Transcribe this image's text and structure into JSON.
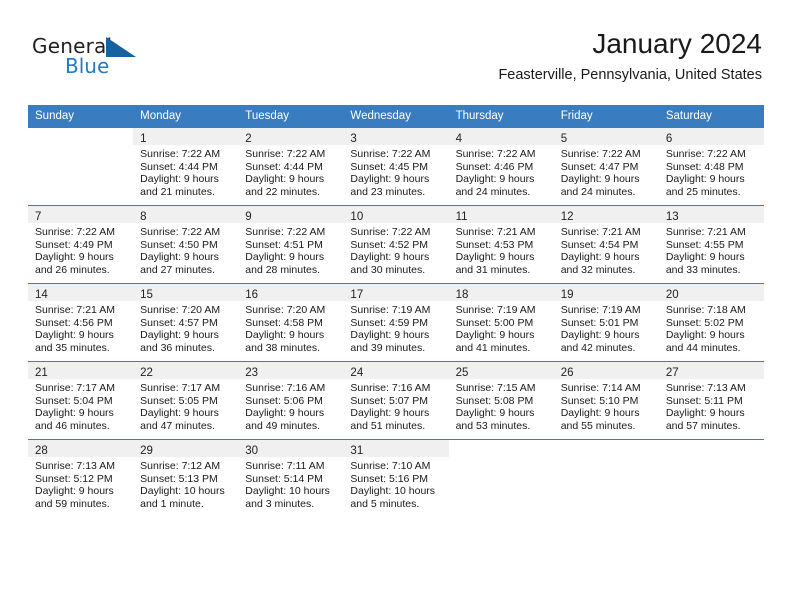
{
  "brand": {
    "word1": "General",
    "word2": "Blue",
    "logo_icon": "triangle-logo-icon",
    "accent_color": "#1e7bc4"
  },
  "header": {
    "title": "January 2024",
    "location": "Feasterville, Pennsylvania, United States"
  },
  "calendar": {
    "header_bg": "#3a7cc0",
    "daynum_bg": "#f0f0f0",
    "weekdays": [
      "Sunday",
      "Monday",
      "Tuesday",
      "Wednesday",
      "Thursday",
      "Friday",
      "Saturday"
    ],
    "weeks": [
      [
        {
          "day": "",
          "lines": []
        },
        {
          "day": "1",
          "lines": [
            "Sunrise: 7:22 AM",
            "Sunset: 4:44 PM",
            "Daylight: 9 hours",
            "and 21 minutes."
          ]
        },
        {
          "day": "2",
          "lines": [
            "Sunrise: 7:22 AM",
            "Sunset: 4:44 PM",
            "Daylight: 9 hours",
            "and 22 minutes."
          ]
        },
        {
          "day": "3",
          "lines": [
            "Sunrise: 7:22 AM",
            "Sunset: 4:45 PM",
            "Daylight: 9 hours",
            "and 23 minutes."
          ]
        },
        {
          "day": "4",
          "lines": [
            "Sunrise: 7:22 AM",
            "Sunset: 4:46 PM",
            "Daylight: 9 hours",
            "and 24 minutes."
          ]
        },
        {
          "day": "5",
          "lines": [
            "Sunrise: 7:22 AM",
            "Sunset: 4:47 PM",
            "Daylight: 9 hours",
            "and 24 minutes."
          ]
        },
        {
          "day": "6",
          "lines": [
            "Sunrise: 7:22 AM",
            "Sunset: 4:48 PM",
            "Daylight: 9 hours",
            "and 25 minutes."
          ]
        }
      ],
      [
        {
          "day": "7",
          "lines": [
            "Sunrise: 7:22 AM",
            "Sunset: 4:49 PM",
            "Daylight: 9 hours",
            "and 26 minutes."
          ]
        },
        {
          "day": "8",
          "lines": [
            "Sunrise: 7:22 AM",
            "Sunset: 4:50 PM",
            "Daylight: 9 hours",
            "and 27 minutes."
          ]
        },
        {
          "day": "9",
          "lines": [
            "Sunrise: 7:22 AM",
            "Sunset: 4:51 PM",
            "Daylight: 9 hours",
            "and 28 minutes."
          ]
        },
        {
          "day": "10",
          "lines": [
            "Sunrise: 7:22 AM",
            "Sunset: 4:52 PM",
            "Daylight: 9 hours",
            "and 30 minutes."
          ]
        },
        {
          "day": "11",
          "lines": [
            "Sunrise: 7:21 AM",
            "Sunset: 4:53 PM",
            "Daylight: 9 hours",
            "and 31 minutes."
          ]
        },
        {
          "day": "12",
          "lines": [
            "Sunrise: 7:21 AM",
            "Sunset: 4:54 PM",
            "Daylight: 9 hours",
            "and 32 minutes."
          ]
        },
        {
          "day": "13",
          "lines": [
            "Sunrise: 7:21 AM",
            "Sunset: 4:55 PM",
            "Daylight: 9 hours",
            "and 33 minutes."
          ]
        }
      ],
      [
        {
          "day": "14",
          "lines": [
            "Sunrise: 7:21 AM",
            "Sunset: 4:56 PM",
            "Daylight: 9 hours",
            "and 35 minutes."
          ]
        },
        {
          "day": "15",
          "lines": [
            "Sunrise: 7:20 AM",
            "Sunset: 4:57 PM",
            "Daylight: 9 hours",
            "and 36 minutes."
          ]
        },
        {
          "day": "16",
          "lines": [
            "Sunrise: 7:20 AM",
            "Sunset: 4:58 PM",
            "Daylight: 9 hours",
            "and 38 minutes."
          ]
        },
        {
          "day": "17",
          "lines": [
            "Sunrise: 7:19 AM",
            "Sunset: 4:59 PM",
            "Daylight: 9 hours",
            "and 39 minutes."
          ]
        },
        {
          "day": "18",
          "lines": [
            "Sunrise: 7:19 AM",
            "Sunset: 5:00 PM",
            "Daylight: 9 hours",
            "and 41 minutes."
          ]
        },
        {
          "day": "19",
          "lines": [
            "Sunrise: 7:19 AM",
            "Sunset: 5:01 PM",
            "Daylight: 9 hours",
            "and 42 minutes."
          ]
        },
        {
          "day": "20",
          "lines": [
            "Sunrise: 7:18 AM",
            "Sunset: 5:02 PM",
            "Daylight: 9 hours",
            "and 44 minutes."
          ]
        }
      ],
      [
        {
          "day": "21",
          "lines": [
            "Sunrise: 7:17 AM",
            "Sunset: 5:04 PM",
            "Daylight: 9 hours",
            "and 46 minutes."
          ]
        },
        {
          "day": "22",
          "lines": [
            "Sunrise: 7:17 AM",
            "Sunset: 5:05 PM",
            "Daylight: 9 hours",
            "and 47 minutes."
          ]
        },
        {
          "day": "23",
          "lines": [
            "Sunrise: 7:16 AM",
            "Sunset: 5:06 PM",
            "Daylight: 9 hours",
            "and 49 minutes."
          ]
        },
        {
          "day": "24",
          "lines": [
            "Sunrise: 7:16 AM",
            "Sunset: 5:07 PM",
            "Daylight: 9 hours",
            "and 51 minutes."
          ]
        },
        {
          "day": "25",
          "lines": [
            "Sunrise: 7:15 AM",
            "Sunset: 5:08 PM",
            "Daylight: 9 hours",
            "and 53 minutes."
          ]
        },
        {
          "day": "26",
          "lines": [
            "Sunrise: 7:14 AM",
            "Sunset: 5:10 PM",
            "Daylight: 9 hours",
            "and 55 minutes."
          ]
        },
        {
          "day": "27",
          "lines": [
            "Sunrise: 7:13 AM",
            "Sunset: 5:11 PM",
            "Daylight: 9 hours",
            "and 57 minutes."
          ]
        }
      ],
      [
        {
          "day": "28",
          "lines": [
            "Sunrise: 7:13 AM",
            "Sunset: 5:12 PM",
            "Daylight: 9 hours",
            "and 59 minutes."
          ]
        },
        {
          "day": "29",
          "lines": [
            "Sunrise: 7:12 AM",
            "Sunset: 5:13 PM",
            "Daylight: 10 hours",
            "and 1 minute."
          ]
        },
        {
          "day": "30",
          "lines": [
            "Sunrise: 7:11 AM",
            "Sunset: 5:14 PM",
            "Daylight: 10 hours",
            "and 3 minutes."
          ]
        },
        {
          "day": "31",
          "lines": [
            "Sunrise: 7:10 AM",
            "Sunset: 5:16 PM",
            "Daylight: 10 hours",
            "and 5 minutes."
          ]
        },
        {
          "day": "",
          "lines": []
        },
        {
          "day": "",
          "lines": []
        },
        {
          "day": "",
          "lines": []
        }
      ]
    ]
  }
}
